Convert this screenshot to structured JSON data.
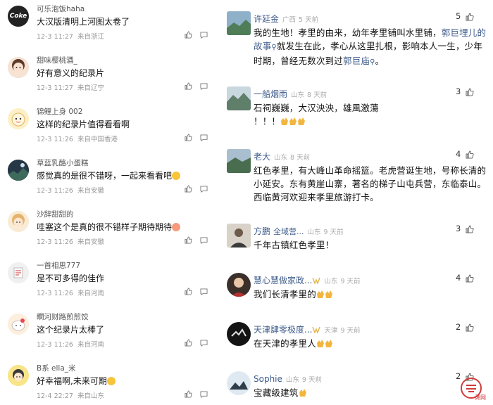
{
  "left_comments": [
    {
      "user": "可乐泡饭haha",
      "text": "大汉版清明上河图太卷了",
      "date": "12-3 11:27",
      "location": "来自浙江",
      "avatar_label": "Coke"
    },
    {
      "user": "甜味樱桃酒_",
      "text": "好有意义的纪录片",
      "date": "12-3 11:27",
      "location": "来自辽宁",
      "avatar_label": ""
    },
    {
      "user": "锦鲤上身 002",
      "text": "这样的纪录片值得看看啊",
      "date": "12-3 11:26",
      "location": "来自中国香港",
      "avatar_label": ""
    },
    {
      "user": "草蓝乳酪小蛋糕",
      "text": "感觉真的是很不错呀，一起来看看吧",
      "date": "12-3 11:26",
      "location": "来自安徽",
      "avatar_label": ""
    },
    {
      "user": "沙辞甜甜的",
      "text": "哇塞这个是真的很不错样子期待期待",
      "date": "12-3 11:26",
      "location": "来自安徽",
      "avatar_label": ""
    },
    {
      "user": "一首相思777",
      "text": "是不可多得的佳作",
      "date": "12-3 11:26",
      "location": "来自河南",
      "avatar_label": ""
    },
    {
      "user": "瞷河财路煎煎饺",
      "text": "这个纪录片太棒了",
      "date": "12-3 11:26",
      "location": "来自河南",
      "avatar_label": ""
    },
    {
      "user": "B系 ella_米",
      "text": "好幸福啊,未来可期",
      "date": "12-4 22:27",
      "location": "来自山东",
      "avatar_label": ""
    }
  ],
  "right_comments": [
    {
      "user": "许延金",
      "location": "广西",
      "time": "5 天前",
      "likes": "5",
      "body_parts": [
        "我的生地！孝里的由来，幼年孝里铺叫水里铺，",
        "郭巨埋儿的故事",
        "就发生在此，孝心从这里扎根，影响本人一生，少年时期，曾经无数次到过",
        "郭巨庙",
        "。"
      ]
    },
    {
      "user": "一船烟雨",
      "location": "山东",
      "time": "8 天前",
      "likes": "3",
      "body_parts": [
        "石祠巍巍，大汉泱泱，雄風激蕩",
        "！！！"
      ]
    },
    {
      "user": "老大",
      "location": "山东",
      "time": "8 天前",
      "likes": "4",
      "body_parts": [
        "红色孝里，有大峰山革命摇篮。老虎营诞生地，号称长清的小延安。东有黄崖山寨，著名的梯子山屯兵营，东临泰山。西临黄河欢迎来孝里旅游打卡。"
      ]
    },
    {
      "user": "方鹏",
      "badge_text": "全域营...",
      "location": "山东",
      "time": "9 天前",
      "likes": "3",
      "body_parts": [
        "千年古镇红色孝里！"
      ]
    },
    {
      "user": "慧心慧做家政...",
      "location": "山东",
      "time": "9 天前",
      "likes": "4",
      "body_parts": [
        "我们长清孝里的"
      ]
    },
    {
      "user": "天津肆零极度...",
      "location": "天津",
      "time": "9 天前",
      "likes": "2",
      "body_parts": [
        "在天津的孝里人"
      ]
    },
    {
      "user": "Sophie",
      "location": "山东",
      "time": "9 天前",
      "likes": "2",
      "body_parts": [
        "宝藏级建筑"
      ]
    }
  ],
  "colors": {
    "link": "#3d5b8a",
    "meta": "#9a9a9a",
    "clap": "#f2b640"
  },
  "watermark": "舜网"
}
